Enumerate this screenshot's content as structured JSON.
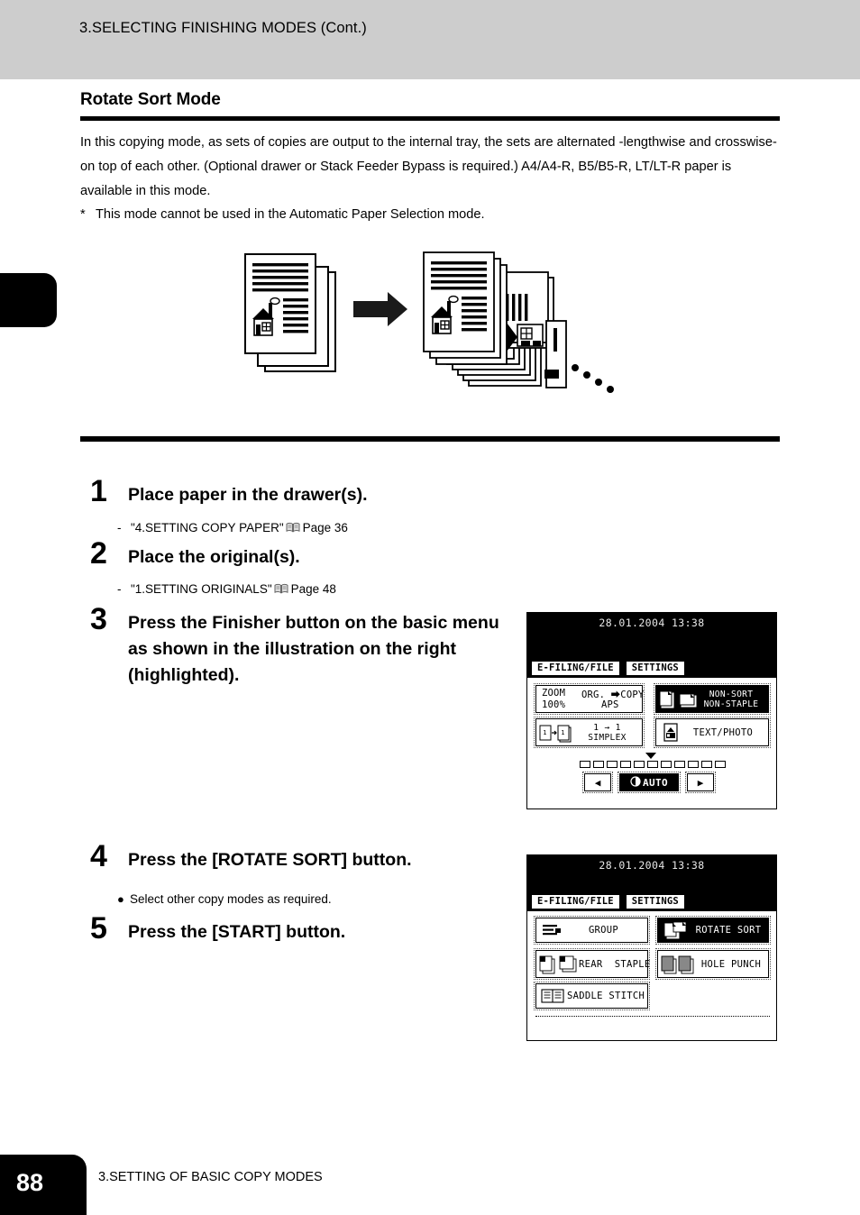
{
  "header": {
    "running_head": "3.SELECTING FINISHING MODES (Cont.)"
  },
  "section": {
    "title": "Rotate Sort Mode",
    "paragraph": "In this copying mode, as sets of copies are output to the internal tray, the sets are alternated -lengthwise and crosswise- on top of each other. (Optional drawer or Stack Feeder Bypass is required.) A4/A4-R, B5/B5-R, LT/LT-R paper is available in this mode.",
    "note_marker": "*",
    "note": "This mode cannot be used in the Automatic Paper Selection mode."
  },
  "steps": [
    {
      "number": "1",
      "text": "Place paper in the drawer(s).",
      "sub_dash": "-",
      "sub_text": "\"4.SETTING COPY PAPER\"",
      "sub_icon": "book-icon",
      "sub_page": "Page 36"
    },
    {
      "number": "2",
      "text": "Place the original(s).",
      "sub_dash": "-",
      "sub_text": "\"1.SETTING ORIGINALS\"",
      "sub_icon": "book-icon",
      "sub_page": "Page 48"
    },
    {
      "number": "3",
      "text": "Press the Finisher button on the basic menu as shown in the illustration on the right (highlighted)."
    },
    {
      "number": "4",
      "text": "Press the [ROTATE SORT] button.",
      "bullet": "●",
      "bullet_text": "Select other copy modes as required."
    },
    {
      "number": "5",
      "text": "Press the [START] button."
    }
  ],
  "lcd_basic": {
    "clock": "28.01.2004 13:38",
    "tabs": [
      {
        "label": "E-FILING/FILE"
      },
      {
        "label": "SETTINGS"
      }
    ],
    "zoom_button": {
      "zoom_label": "ZOOM",
      "zoom_value": "100%",
      "org_copy_label": "ORG. ⮕COPY",
      "aps_value": "APS"
    },
    "finisher_button": {
      "line1": "NON-SORT",
      "line2": "NON-STAPLE",
      "selected": true,
      "icon": "sort-pages-icon"
    },
    "duplex_button": {
      "line1": "1 → 1",
      "line2": "SIMPLEX",
      "icon": "simplex-icon"
    },
    "original_mode_button": {
      "label": "TEXT/PHOTO",
      "icon": "text-photo-icon"
    },
    "density": {
      "segments": 11,
      "marker_index": 5,
      "left_arrow": "◀",
      "right_arrow": "▶",
      "auto_label": "AUTO",
      "auto_selected": true,
      "auto_icon": "density-dial-icon"
    }
  },
  "lcd_finishing": {
    "clock": "28.01.2004 13:38",
    "tabs": [
      {
        "label": "E-FILING/FILE"
      },
      {
        "label": "SETTINGS"
      }
    ],
    "buttons": [
      {
        "label": "GROUP",
        "icon": "group-icon",
        "selected": false
      },
      {
        "label": "ROTATE SORT",
        "icon": "rotate-sort-icon",
        "selected": true
      },
      {
        "label": "REAR  STAPLE",
        "icon": "rear-staple-icon",
        "selected": false
      },
      {
        "label": "HOLE PUNCH",
        "icon": "hole-punch-icon",
        "selected": false
      },
      {
        "label": "SADDLE STITCH",
        "icon": "saddle-stitch-icon",
        "selected": false
      }
    ]
  },
  "footer": {
    "page_number": "88",
    "chapter": "3.SETTING OF BASIC COPY MODES"
  },
  "colors": {
    "header_band": "#cdcdcd",
    "ink": "#000000",
    "paper": "#ffffff"
  }
}
